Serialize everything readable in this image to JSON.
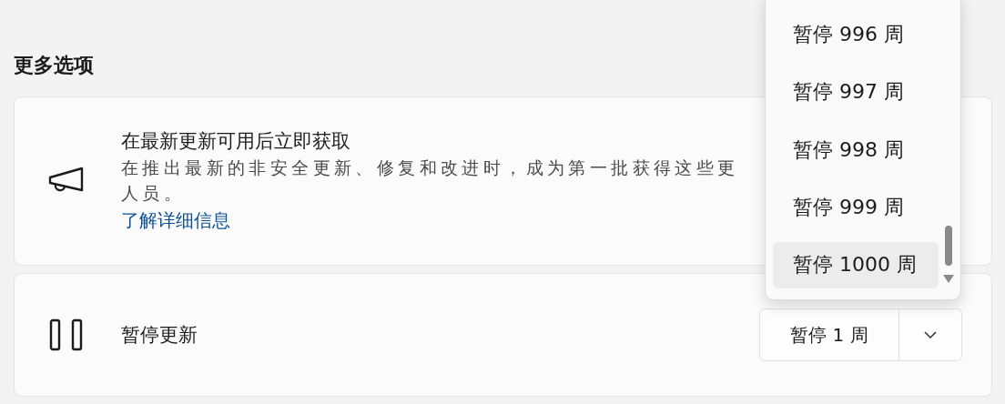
{
  "section_title": "更多选项",
  "insider_card": {
    "title": "在最新更新可用后立即获取",
    "description_lines": [
      "在推出最新的非安全更新、修复和改进时，成为第一批获得这些更",
      "人员。"
    ],
    "link": "了解详细信息"
  },
  "pause_card": {
    "title": "暂停更新",
    "button": "暂停 1 周"
  },
  "dropdown": {
    "options": [
      {
        "label": "暂停 996 周",
        "selected": false
      },
      {
        "label": "暂停 997 周",
        "selected": false
      },
      {
        "label": "暂停 998 周",
        "selected": false
      },
      {
        "label": "暂停 999 周",
        "selected": false
      },
      {
        "label": "暂停 1000 周",
        "selected": true
      }
    ]
  }
}
